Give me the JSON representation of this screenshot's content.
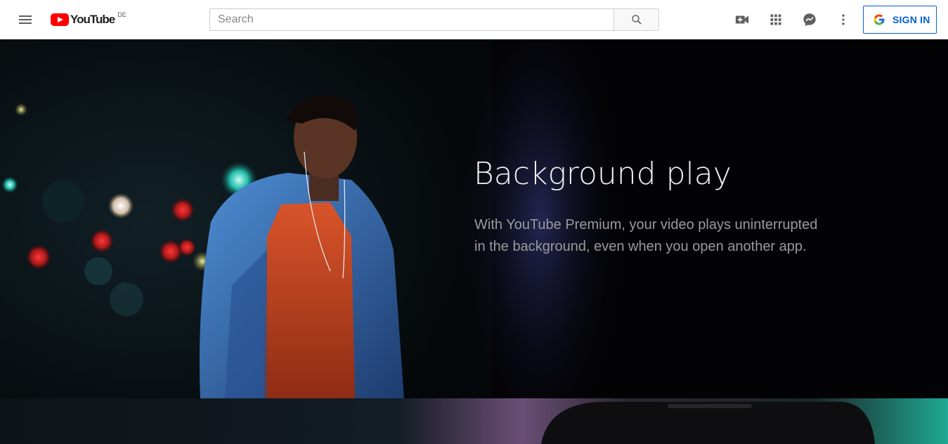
{
  "masthead": {
    "logo_text": "YouTube",
    "country_code": "DE",
    "search": {
      "placeholder": "Search",
      "value": ""
    },
    "icons": [
      "menu-icon",
      "search-icon",
      "create-video-icon",
      "apps-grid-icon",
      "messages-icon",
      "more-vert-icon"
    ],
    "sign_in_label": "SIGN IN",
    "accent_color": "#065fd4",
    "brand_color": "#ff0000"
  },
  "hero": {
    "title": "Background play",
    "description": "With YouTube Premium, your video plays uninterrupted in the background, even when you open another app."
  }
}
